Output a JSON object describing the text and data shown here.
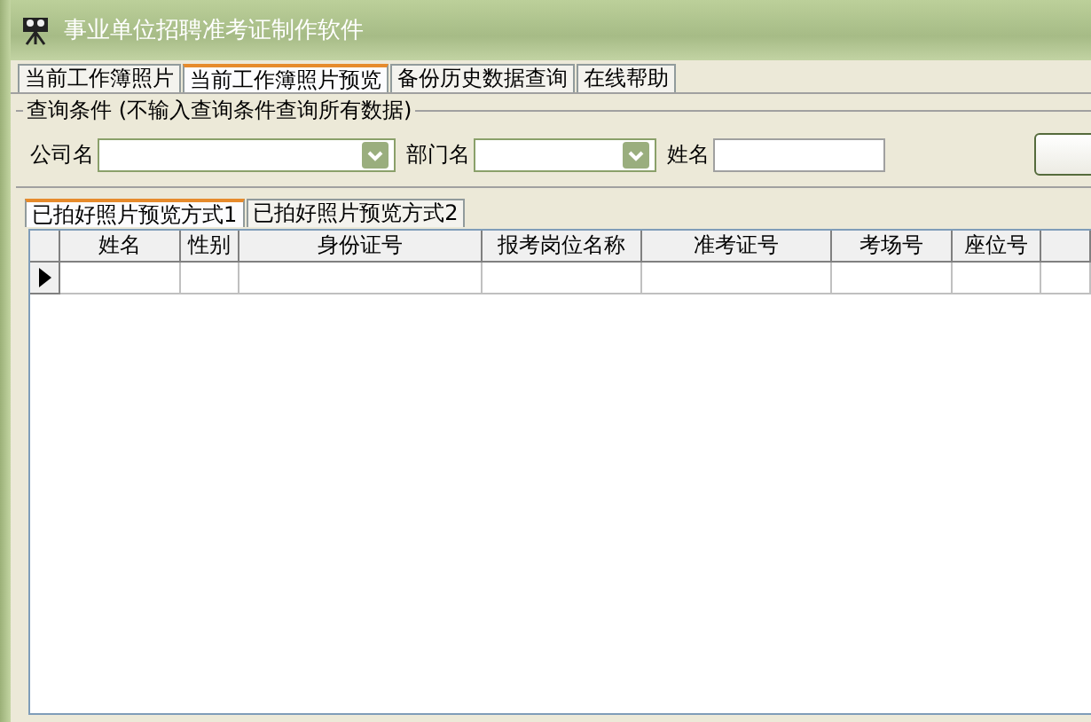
{
  "window": {
    "title": "事业单位招聘准考证制作软件"
  },
  "tabs": [
    {
      "label": "当前工作簿照片",
      "selected": false
    },
    {
      "label": "当前工作簿照片预览",
      "selected": true
    },
    {
      "label": "备份历史数据查询",
      "selected": false
    },
    {
      "label": "在线帮助",
      "selected": false
    }
  ],
  "query": {
    "group_title": "查询条件 (不输入查询条件查询所有数据)",
    "fields": [
      {
        "label": "公司名",
        "kind": "dropdown"
      },
      {
        "label": "部门名",
        "kind": "dropdown"
      },
      {
        "label": "姓名",
        "kind": "text"
      }
    ]
  },
  "sub_tabs": [
    {
      "label": "已拍好照片预览方式1",
      "selected": true
    },
    {
      "label": "已拍好照片预览方式2",
      "selected": false
    }
  ],
  "table": {
    "columns": [
      "姓名",
      "性别",
      "身份证号",
      "报考岗位名称",
      "准考证号",
      "考场号",
      "座位号"
    ],
    "rows": [
      {
        "selected": true
      }
    ]
  }
}
